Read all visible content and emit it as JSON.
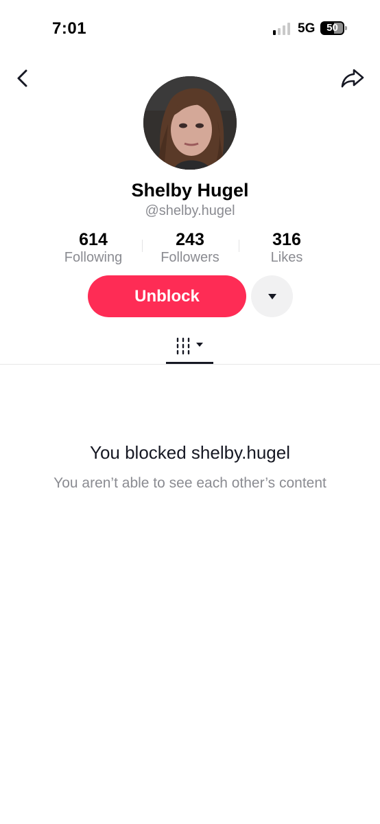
{
  "status_bar": {
    "time": "7:01",
    "network": "5G",
    "battery": "50",
    "signal_bars_active": 1,
    "signal_bars_total": 4
  },
  "nav": {
    "back_icon": "chevron-left-icon",
    "share_icon": "share-arrow-icon"
  },
  "profile": {
    "display_name": "Shelby Hugel",
    "username": "@shelby.hugel"
  },
  "stats": [
    {
      "value": "614",
      "label": "Following"
    },
    {
      "value": "243",
      "label": "Followers"
    },
    {
      "value": "316",
      "label": "Likes"
    }
  ],
  "actions": {
    "unblock_label": "Unblock",
    "more_icon": "caret-down-icon"
  },
  "tabs": {
    "active_icon": "grid-filter-icon"
  },
  "blocked_state": {
    "title": "You blocked shelby.hugel",
    "subtitle": "You aren’t able to see each other’s content"
  },
  "colors": {
    "accent": "#fe2c55",
    "text_primary": "#161823",
    "text_secondary": "#8a8b91",
    "secondary_button_bg": "#f1f1f2"
  }
}
